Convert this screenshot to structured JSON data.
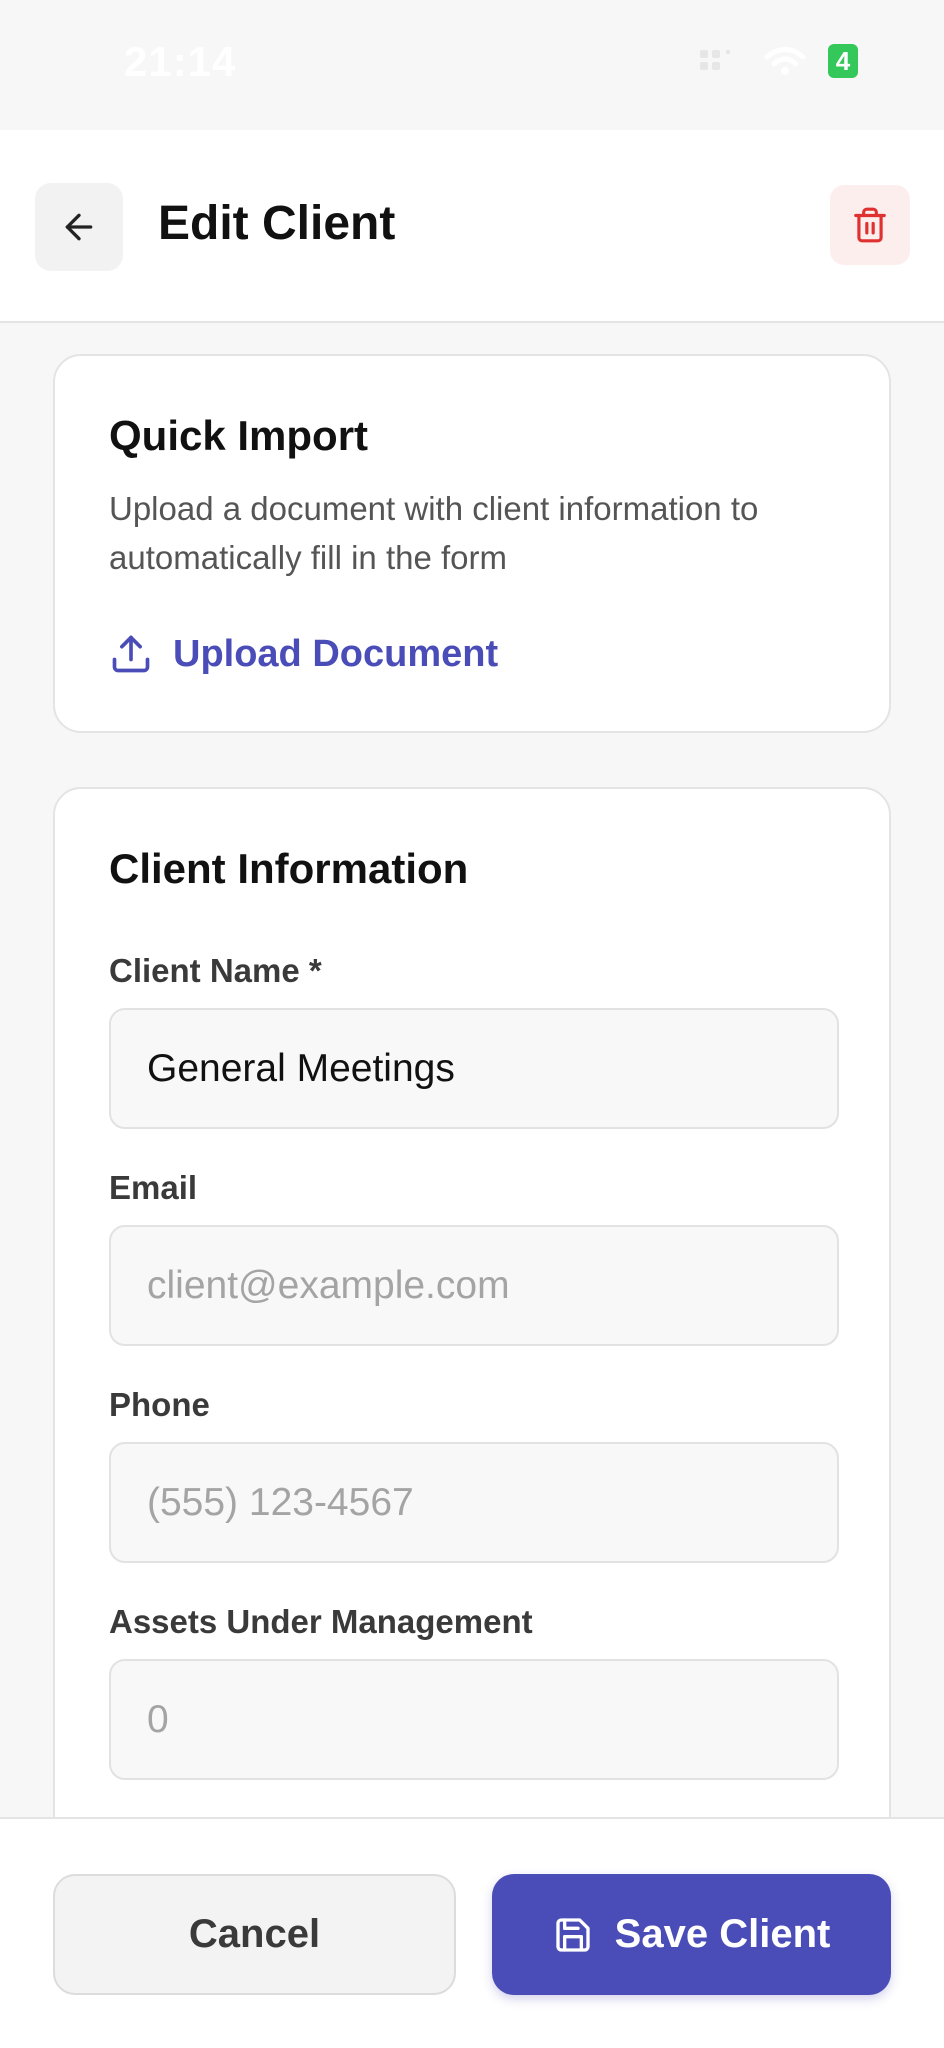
{
  "status_bar": {
    "time": "21:14",
    "battery": "4"
  },
  "header": {
    "title": "Edit Client",
    "back_icon": "arrow-left-icon",
    "delete_icon": "trash-icon"
  },
  "quick_import": {
    "title": "Quick Import",
    "description": "Upload a document with client information to automatically fill in the form",
    "upload_label": "Upload Document",
    "upload_icon": "upload-icon"
  },
  "client_info": {
    "title": "Client Information",
    "fields": {
      "name": {
        "label": "Client Name *",
        "value": "General Meetings",
        "placeholder": ""
      },
      "email": {
        "label": "Email",
        "value": "",
        "placeholder": "client@example.com"
      },
      "phone": {
        "label": "Phone",
        "value": "",
        "placeholder": "(555) 123-4567"
      },
      "aum": {
        "label": "Assets Under Management",
        "value": "",
        "placeholder": "0"
      }
    }
  },
  "actions": {
    "cancel_label": "Cancel",
    "save_label": "Save Client",
    "save_icon": "save-icon"
  },
  "colors": {
    "accent": "#4a4db8",
    "danger": "#e03131",
    "danger_bg": "#fdeeee"
  }
}
